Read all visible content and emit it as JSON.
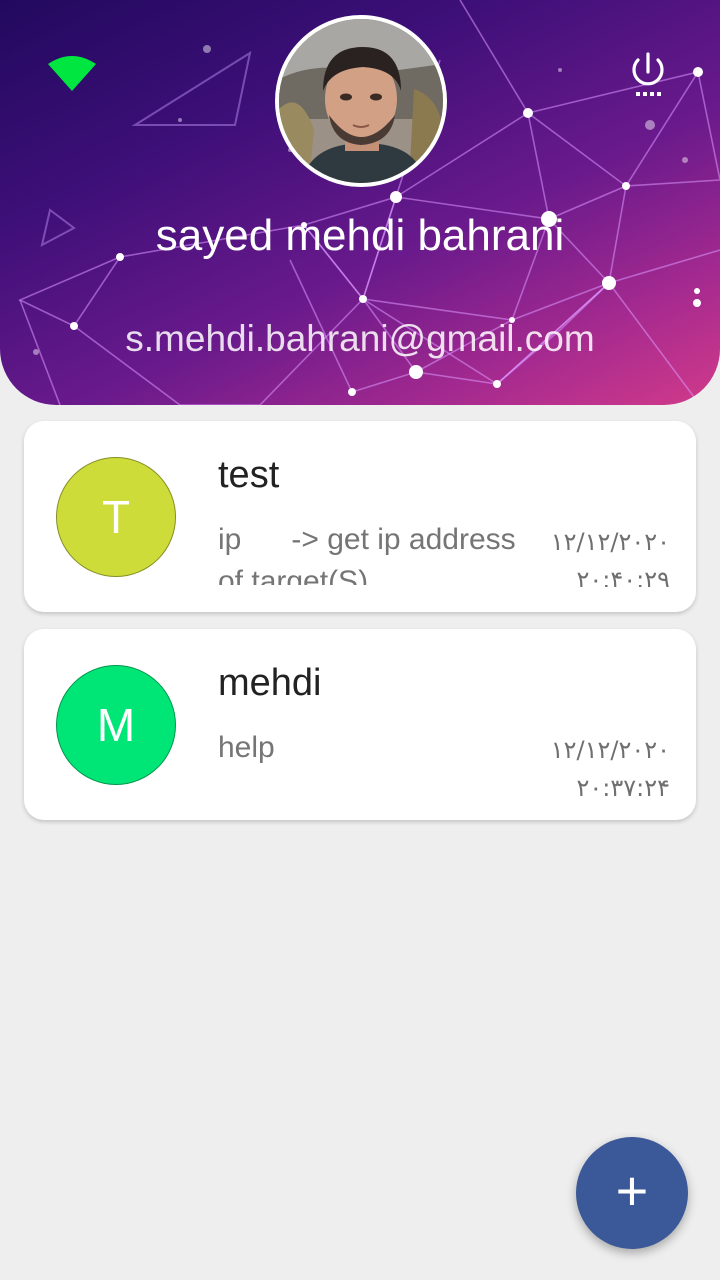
{
  "header": {
    "user_name": "sayed mehdi bahrani",
    "email": "s.mehdi.bahrani@gmail.com",
    "connection_icon": "wifi-icon",
    "power_icon": "power-icon"
  },
  "conversations": [
    {
      "initial": "T",
      "avatar_color": "#cddc39",
      "title": "test",
      "preview": "ip      -> get ip address of target(S)",
      "date": "۱۲/۱۲/۲۰۲۰",
      "time": "۲۰:۴۰:۲۹"
    },
    {
      "initial": "M",
      "avatar_color": "#00e676",
      "title": "mehdi",
      "preview": "help",
      "date": "۱۲/۱۲/۲۰۲۰",
      "time": "۲۰:۳۷:۲۴"
    }
  ],
  "fab": {
    "label": "+",
    "color": "#3b5998"
  },
  "colors": {
    "wifi": "#00e640",
    "background": "#eeeeee"
  }
}
